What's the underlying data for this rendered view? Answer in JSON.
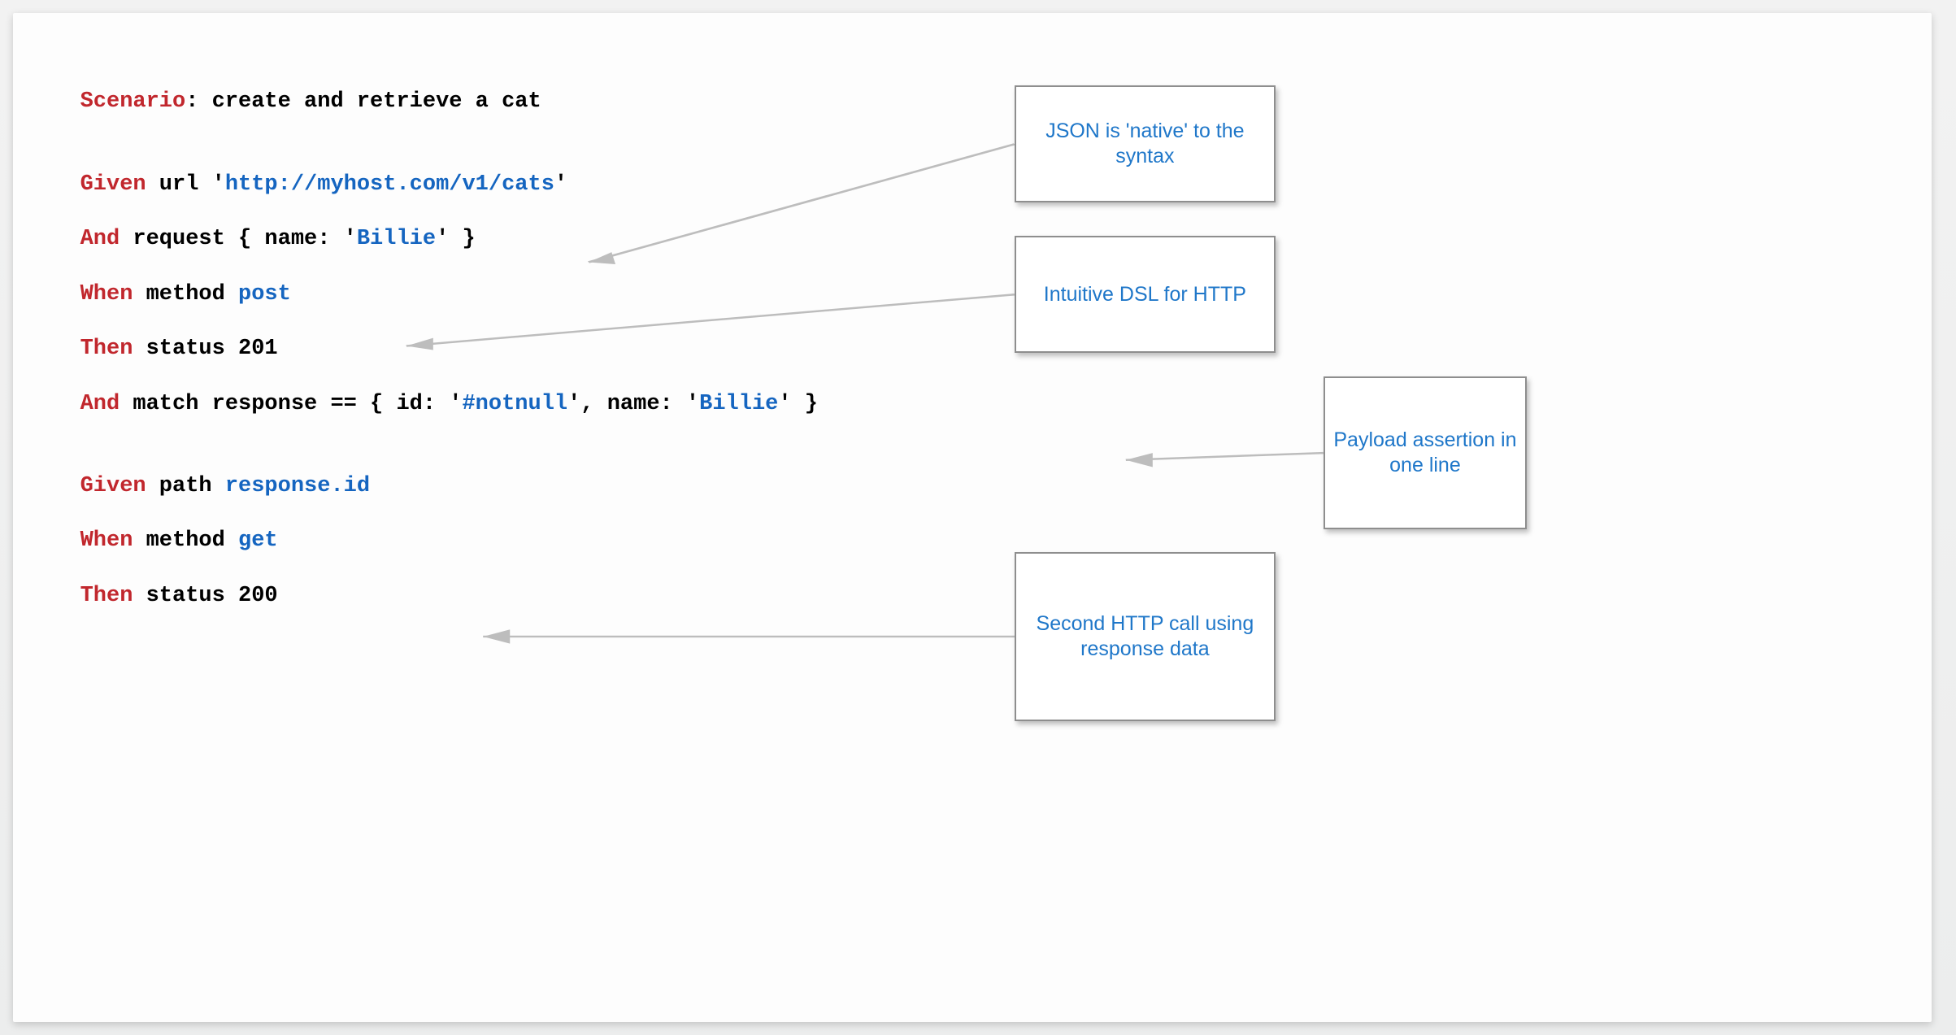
{
  "callouts": {
    "c1": "JSON is 'native' to the syntax",
    "c2": "Intuitive DSL for HTTP",
    "c3": "Payload assertion in one line",
    "c4": "Second HTTP call using response data"
  },
  "code": {
    "l1": {
      "kw": "Scenario",
      "rest": ": create and retrieve a cat"
    },
    "l2": "",
    "l3": "",
    "l4": {
      "kw": "Given",
      "a": " url '",
      "lit": "http://myhost.com/v1/cats",
      "b": "'"
    },
    "l5": "",
    "l6": {
      "kw": "And",
      "a": " request { name: '",
      "lit": "Billie",
      "b": "' }"
    },
    "l7": "",
    "l8": {
      "kw": "When",
      "a": " method ",
      "lit": "post"
    },
    "l9": "",
    "l10": {
      "kw": "Then",
      "a": " status 201"
    },
    "l11": "",
    "l12": {
      "kw": "And",
      "a": " match response == { id: '",
      "lit1": "#notnull",
      "b": "', name: '",
      "lit2": "Billie",
      "c": "' }"
    },
    "l13": "",
    "l14": "",
    "l15": {
      "kw": "Given",
      "a": " path ",
      "lit": "response.id"
    },
    "l16": "",
    "l17": {
      "kw": "When",
      "a": " method ",
      "lit": "get"
    },
    "l18": "",
    "l19": {
      "kw": "Then",
      "a": " status 200"
    }
  }
}
